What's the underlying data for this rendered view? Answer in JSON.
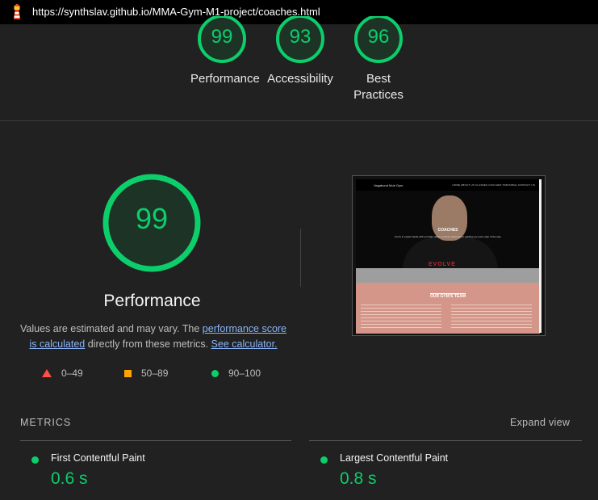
{
  "browser": {
    "url": "https://synthslav.github.io/MMA-Gym-M1-project/coaches.html",
    "logo_icon": "lighthouse-icon"
  },
  "gauges": [
    {
      "score": "99",
      "label": "Performance"
    },
    {
      "score": "93",
      "label": "Accessibility"
    },
    {
      "score": "96",
      "label_line1": "Best",
      "label_line2": "Practices"
    }
  ],
  "performance": {
    "score": "99",
    "title": "Performance",
    "desc_text1": "Values are estimated and may vary. The ",
    "desc_link1": "performance score is calculated",
    "desc_text2": " directly from these metrics. ",
    "desc_link2": "See calculator."
  },
  "legend": {
    "fail": "0–49",
    "average": "50–89",
    "pass": "90–100"
  },
  "screenshot": {
    "brand": "Vagabond Mob Gym",
    "menu": "HOME   ABOUT US   CLASSES   COACHES   TIMETABLE   CONTACT US",
    "hero_title": "COACHES",
    "hero_sub": "You're in expert hands with our high-caliber coaches dedicated to guiding you every step of the way.",
    "shirt_logo": "EVOLVE",
    "section_title": "OUR GYM'S TEAM"
  },
  "metrics": {
    "heading": "METRICS",
    "expand": "Expand view",
    "items": [
      {
        "title": "First Contentful Paint",
        "value": "0.6 s"
      },
      {
        "title": "Largest Contentful Paint",
        "value": "0.8 s"
      }
    ]
  },
  "colors": {
    "pass": "#0cce6b",
    "average": "#ffa400",
    "fail": "#ff4e42",
    "background": "#212121"
  }
}
